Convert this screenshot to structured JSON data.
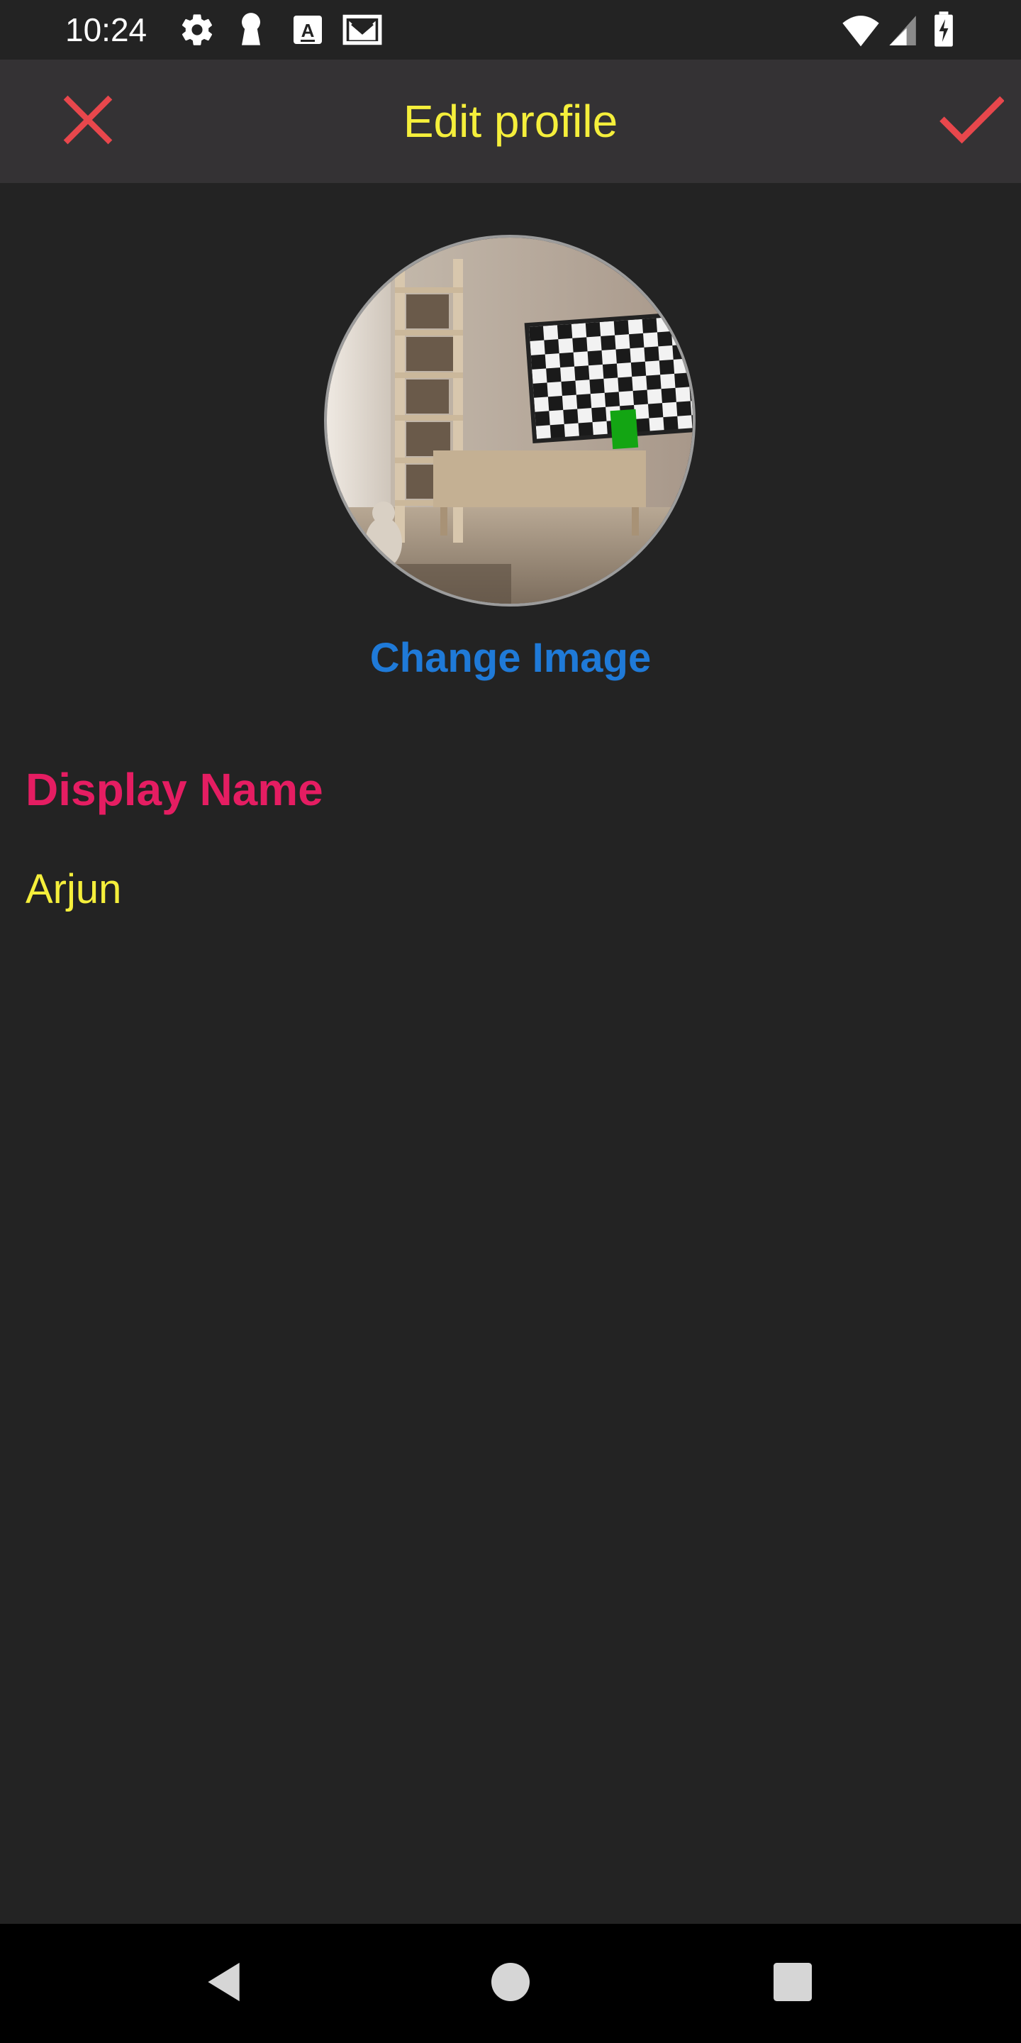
{
  "status_bar": {
    "time": "10:24",
    "icons": [
      "settings-icon",
      "keyhole-icon",
      "keyboard-a-icon",
      "gmail-icon",
      "wifi-icon",
      "signal-icon",
      "battery-charging-icon"
    ]
  },
  "app_bar": {
    "title": "Edit profile",
    "close_icon": "close-icon",
    "confirm_icon": "check-icon"
  },
  "profile": {
    "change_image_label": "Change Image",
    "display_name_label": "Display Name",
    "display_name_value": "Arjun"
  },
  "nav_bar": {
    "icons": [
      "back-icon",
      "home-icon",
      "recents-icon"
    ]
  },
  "colors": {
    "background": "#232323",
    "app_bar": "#343234",
    "title": "#f5ef3b",
    "accent_red": "#e8474c",
    "link_blue": "#1f7ad8",
    "label_pink": "#e51d62",
    "value_yellow": "#f5ef3b"
  }
}
